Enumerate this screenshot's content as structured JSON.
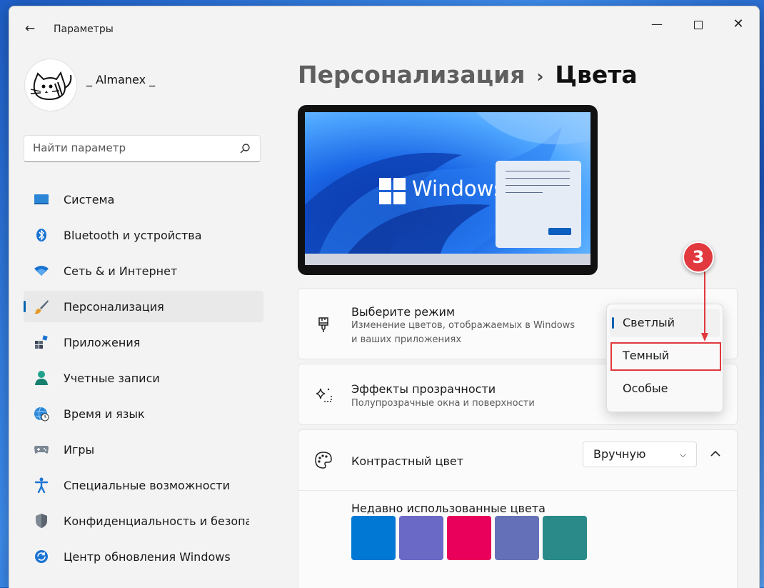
{
  "window": {
    "title": "Параметры"
  },
  "user": {
    "name": "_ Almanex _"
  },
  "search": {
    "placeholder": "Найти параметр"
  },
  "sidebar": {
    "items": [
      {
        "label": "Система",
        "icon": "monitor-icon"
      },
      {
        "label": "Bluetooth и устройства",
        "icon": "bluetooth-icon"
      },
      {
        "label": "Сеть & и Интернет",
        "icon": "wifi-icon"
      },
      {
        "label": "Персонализация",
        "icon": "brush-icon",
        "active": true
      },
      {
        "label": "Приложения",
        "icon": "apps-icon"
      },
      {
        "label": "Учетные записи",
        "icon": "person-icon"
      },
      {
        "label": "Время и язык",
        "icon": "globe-clock-icon"
      },
      {
        "label": "Игры",
        "icon": "gamepad-icon"
      },
      {
        "label": "Специальные возможности",
        "icon": "accessibility-icon"
      },
      {
        "label": "Конфиденциальность и безопас",
        "icon": "shield-icon"
      },
      {
        "label": "Центр обновления Windows",
        "icon": "update-icon"
      }
    ]
  },
  "header": {
    "parent": "Персонализация",
    "separator": "›",
    "current": "Цвета"
  },
  "preview": {
    "brand_text": "Windows"
  },
  "mode_card": {
    "title": "Выберите режим",
    "subtitle_line1": "Изменение цветов, отображаемых в Windows",
    "subtitle_line2": "и ваших приложениях"
  },
  "transparency_card": {
    "title": "Эффекты прозрачности",
    "subtitle": "Полупрозрачные окна и поверхности"
  },
  "accent_card": {
    "title": "Контрастный цвет",
    "dropdown_value": "Вручную",
    "recent_label": "Недавно использованные цвета",
    "swatches": [
      "#0078d4",
      "#6b69c6",
      "#e8005a",
      "#6471b8",
      "#2a8a8a"
    ]
  },
  "mode_flyout": {
    "options": [
      {
        "label": "Светлый",
        "selected": true
      },
      {
        "label": "Темный"
      },
      {
        "label": "Особые"
      }
    ]
  },
  "annotation": {
    "step_number": "3",
    "color": "#e1393e"
  }
}
